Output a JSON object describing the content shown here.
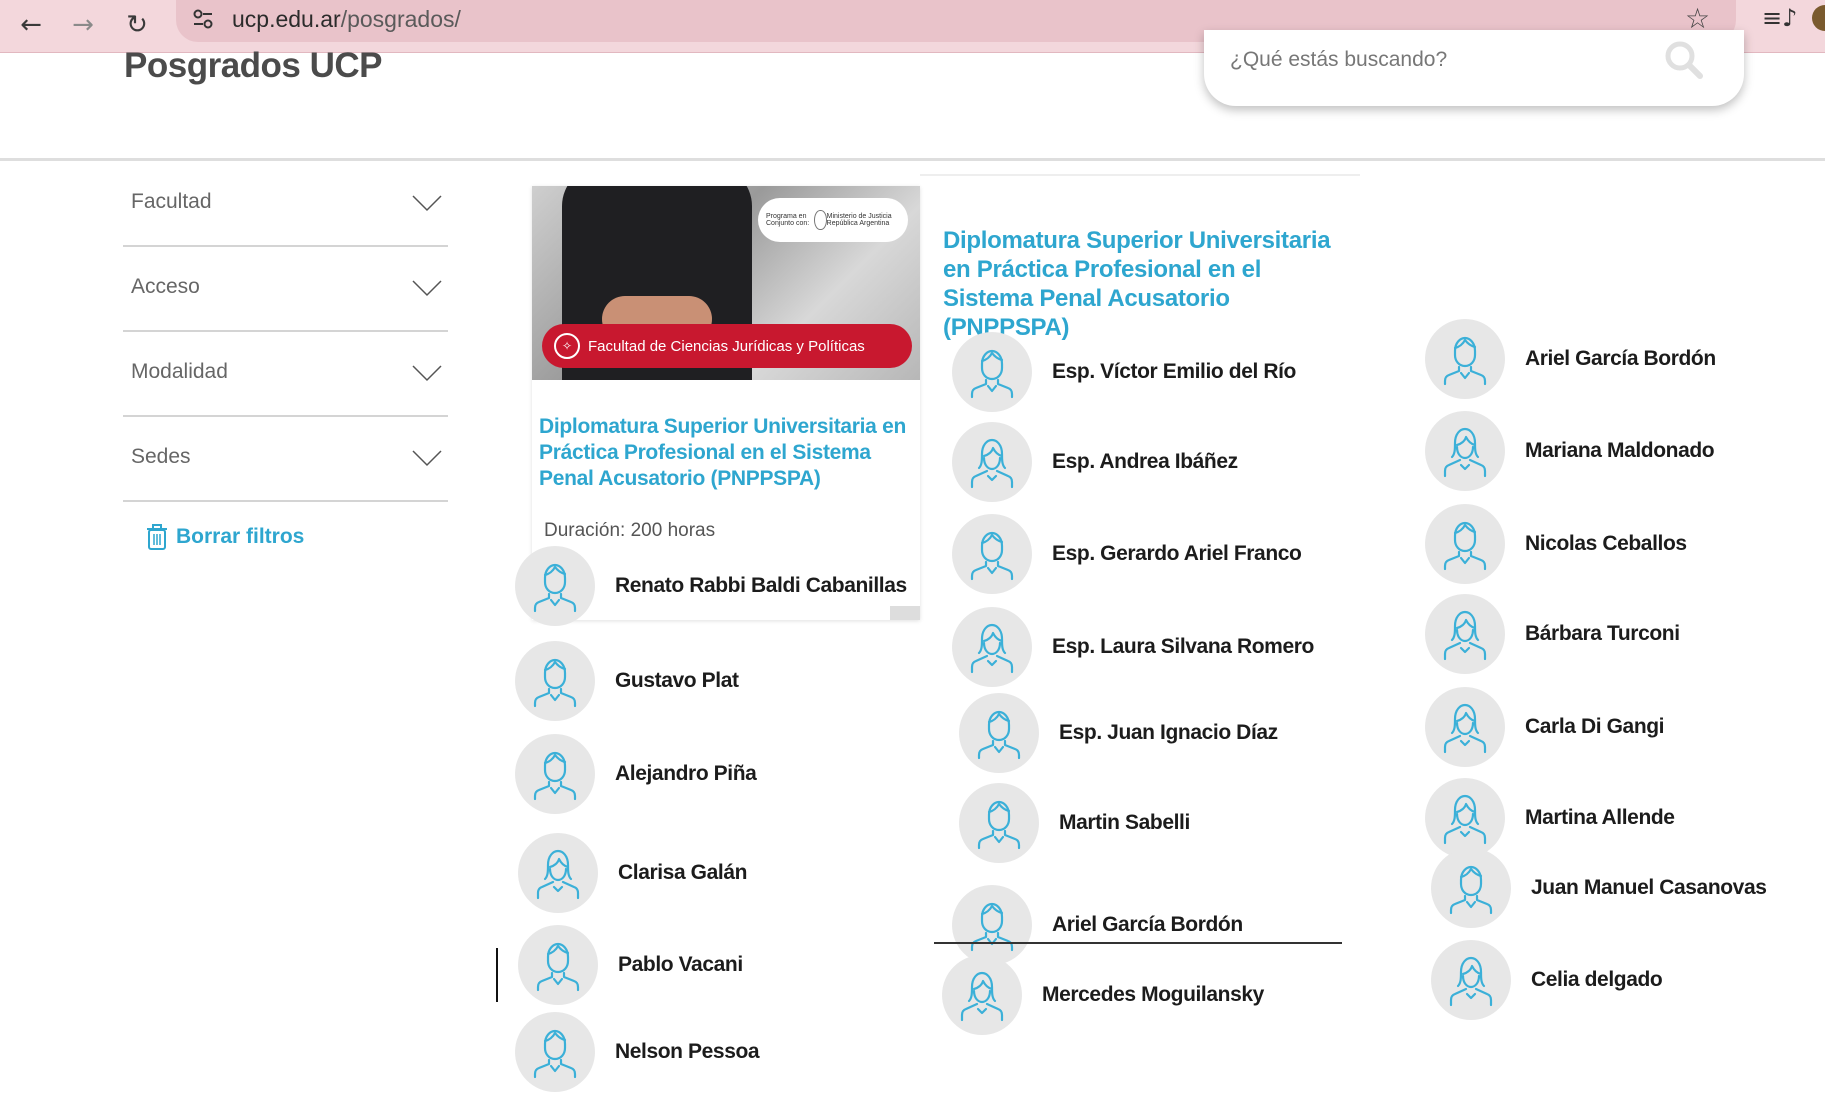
{
  "browser": {
    "url_domain": "ucp.edu.ar",
    "url_path": "/posgrados/",
    "back_glyph": "←",
    "forward_glyph": "→",
    "reload_glyph": "↻",
    "star_glyph": "☆",
    "queue_glyph": "≡♪"
  },
  "header": {
    "site_title": "Posgrados UCP",
    "search_placeholder": "¿Qué estás buscando?"
  },
  "filters": {
    "items": [
      {
        "label": "Facultad"
      },
      {
        "label": "Acceso"
      },
      {
        "label": "Modalidad"
      },
      {
        "label": "Sedes"
      }
    ],
    "clear_label": "Borrar filtros"
  },
  "card": {
    "partner_text_1": "Programa en Conjunto con:",
    "partner_text_2": "Ministerio de Justicia República Argentina",
    "faculty": "Facultad de Ciencias Jurídicas y Políticas",
    "title": "Diplomatura Superior Universitaria en Práctica Profesional en el Sistema Penal Acusatorio (PNPPSPA)",
    "duration": "Duración: 200 horas"
  },
  "column2": {
    "title": "Diplomatura Superior Universitaria en Práctica Profesional en el Sistema Penal Acusatorio (PNPPSPA)"
  },
  "people_col1": [
    {
      "name": "Renato Rabbi Baldi Cabanillas",
      "gender": "m"
    },
    {
      "name": "Gustavo Plat",
      "gender": "m"
    },
    {
      "name": "Alejandro Piña",
      "gender": "m"
    },
    {
      "name": "Clarisa Galán",
      "gender": "f"
    },
    {
      "name": "Pablo Vacani",
      "gender": "m"
    },
    {
      "name": "Nelson Pessoa",
      "gender": "m"
    }
  ],
  "people_col2": [
    {
      "name": "Esp. Víctor Emilio del Río",
      "gender": "m"
    },
    {
      "name": "Esp. Andrea Ibáñez",
      "gender": "f"
    },
    {
      "name": "Esp. Gerardo Ariel Franco",
      "gender": "m"
    },
    {
      "name": "Esp. Laura Silvana Romero",
      "gender": "f"
    },
    {
      "name": "Esp. Juan Ignacio Díaz",
      "gender": "m"
    },
    {
      "name": "Martin Sabelli",
      "gender": "m"
    },
    {
      "name": "Ariel García Bordón",
      "gender": "m"
    },
    {
      "name": "Mercedes Moguilansky",
      "gender": "f"
    }
  ],
  "people_col3": [
    {
      "name": "Ariel García Bordón",
      "gender": "m"
    },
    {
      "name": "Mariana Maldonado",
      "gender": "f"
    },
    {
      "name": "Nicolas Ceballos",
      "gender": "m"
    },
    {
      "name": "Bárbara Turconi",
      "gender": "f"
    },
    {
      "name": "Carla Di Gangi",
      "gender": "f"
    },
    {
      "name": "Martina Allende",
      "gender": "f"
    },
    {
      "name": "Juan Manuel Casanovas",
      "gender": "m"
    },
    {
      "name": "Celia delgado",
      "gender": "f"
    }
  ],
  "colors": {
    "accent": "#2ea6cf",
    "brand_red": "#c8182f",
    "browser_bar": "#f3d7dc"
  }
}
